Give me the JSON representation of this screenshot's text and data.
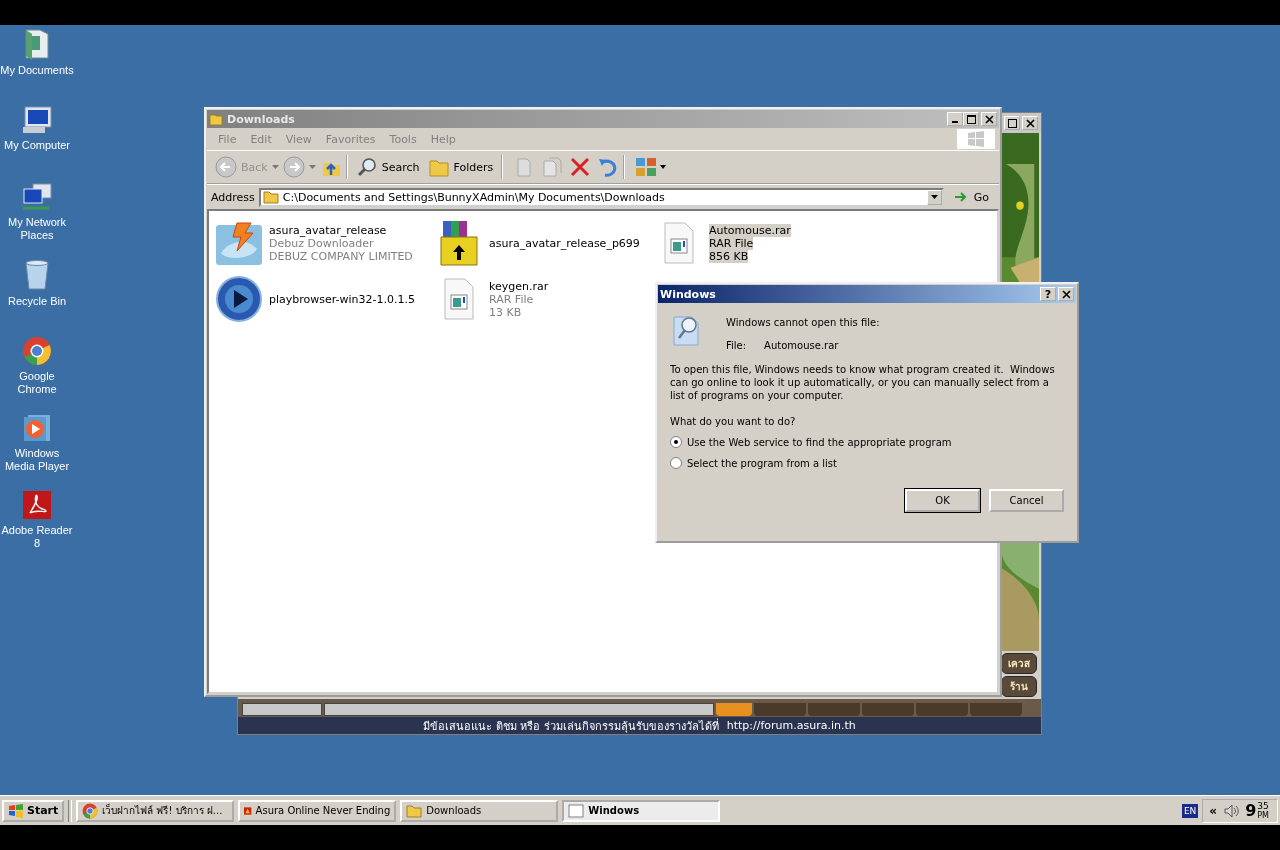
{
  "desktop_icons": [
    {
      "kind": "documents",
      "label": "My Documents"
    },
    {
      "kind": "computer",
      "label": "My Computer"
    },
    {
      "kind": "network",
      "label": "My Network Places"
    },
    {
      "kind": "recycle",
      "label": "Recycle Bin"
    },
    {
      "kind": "chrome",
      "label": "Google Chrome"
    },
    {
      "kind": "media",
      "label": "Windows Media Player"
    },
    {
      "kind": "pdf",
      "label": "Adobe Reader 8"
    }
  ],
  "game_window": {
    "side_buttons": [
      "เควส",
      "ร้าน"
    ],
    "status_text": "มีข้อเสนอแนะ ติชม หรือ ร่วมเล่นกิจกรรมลุ้นรับของรางวัลได้ที่",
    "status_link": "http://forum.asura.in.th"
  },
  "explorer": {
    "title": "Downloads",
    "menu": [
      "File",
      "Edit",
      "View",
      "Favorites",
      "Tools",
      "Help"
    ],
    "toolbar": {
      "back": "Back",
      "back_disabled": true,
      "search": "Search",
      "folders": "Folders"
    },
    "address_label": "Address",
    "address": "C:\\Documents and Settings\\BunnyXAdmin\\My Documents\\Downloads",
    "go": "Go",
    "files": [
      {
        "kind": "installer",
        "name": "asura_avatar_release",
        "details": [
          "Debuz Downloader",
          "DEBUZ COMPANY LIMITED"
        ],
        "selected": false
      },
      {
        "kind": "archive",
        "name": "asura_avatar_release_p699",
        "selected": false
      },
      {
        "kind": "document",
        "name": "Automouse.rar",
        "details": [
          "RAR File",
          "856 KB"
        ],
        "selected": true
      },
      {
        "kind": "player",
        "name": "playbrowser-win32-1.0.1.5",
        "selected": false
      },
      {
        "kind": "document",
        "name": "keygen.rar",
        "details": [
          "RAR File",
          "13 KB"
        ],
        "selected": false
      }
    ]
  },
  "dialog": {
    "title": "Windows",
    "help": "?",
    "heading": "Windows cannot open this file:",
    "file_label": "File:",
    "file_name": "Automouse.rar",
    "body": "To open this file, Windows needs to know what program created it.  Windows can go online to look it up automatically, or you can manually select from a list of programs on your computer.",
    "question": "What do you want to do?",
    "options": [
      {
        "label": "Use the Web service to find the appropriate program",
        "selected": true
      },
      {
        "label": "Select the program from a list",
        "selected": false
      }
    ],
    "buttons": [
      "OK",
      "Cancel"
    ]
  },
  "taskbar": {
    "start": "Start",
    "tasks": [
      {
        "kind": "chrome",
        "label": "เว็บฝากไฟล์ ฟรี! บริการ ฝ...",
        "selected": false
      },
      {
        "kind": "game",
        "label": "Asura Online Never Ending",
        "selected": false
      },
      {
        "kind": "folder",
        "label": "Downloads",
        "selected": false
      },
      {
        "kind": "dialog",
        "label": "Windows",
        "selected": true
      }
    ],
    "language": "EN",
    "expand": "«",
    "clock": {
      "hour": "9",
      "minute": "35",
      "period": "PM"
    }
  }
}
